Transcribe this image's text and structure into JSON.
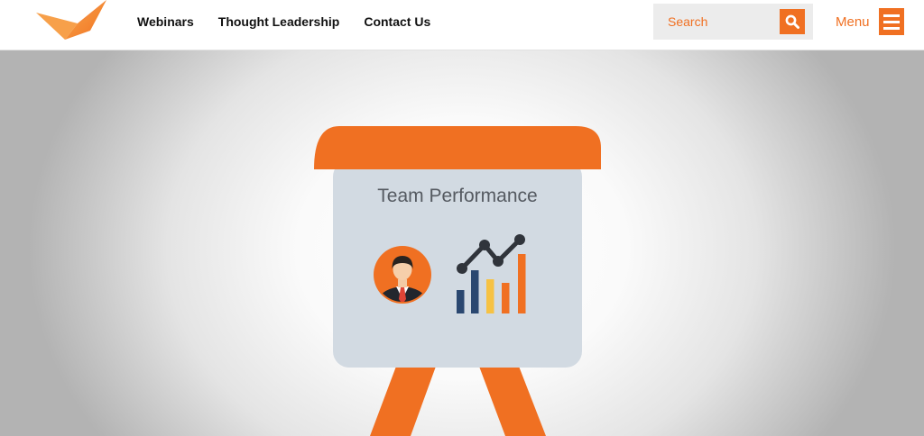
{
  "header": {
    "nav": [
      "Webinars",
      "Thought Leadership",
      "Contact Us"
    ],
    "search": {
      "placeholder": "Search",
      "icon": "search-icon"
    },
    "menu": {
      "label": "Menu",
      "icon": "hamburger-icon"
    }
  },
  "hero": {
    "board_title": "Team Performance",
    "icons": [
      "presentation-board",
      "person-avatar-icon",
      "bar-chart-icon",
      "trend-line-icon"
    ]
  },
  "colors": {
    "accent": "#f07022",
    "board": "#d2dae2",
    "bar_navy": "#2a4770",
    "bar_yellow": "#f6c244"
  }
}
